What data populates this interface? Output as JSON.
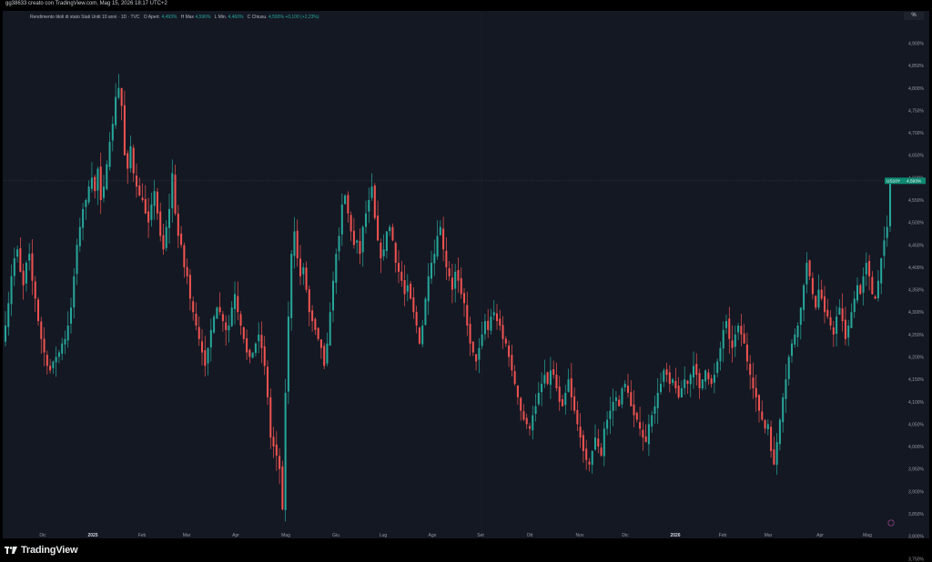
{
  "header": {
    "text": "gg38633 creato con TradingView.com, Mag 15, 2026 18:17 UTC+2"
  },
  "legend": {
    "symbol": "Rendimento titoli di stato Stati Uniti 10 anni · 1D · TVC",
    "open_label": "O",
    "open_name": "Apert.",
    "open": "4,493%",
    "high_label": "H",
    "high_name": "Max",
    "high": "4,596%",
    "low_label": "L",
    "low_name": "Min.",
    "low": "4,460%",
    "close_label": "C",
    "close_name": "Chiusu.",
    "close": "4,593%",
    "change": "+0,100 (+2,23%)"
  },
  "controls": {
    "percent_button": "%"
  },
  "price_tag": {
    "symbol": "US10Y",
    "value": "4,593%"
  },
  "footer": {
    "brand": "TradingView"
  },
  "colors": {
    "up": "#26a69a",
    "down": "#ef5350",
    "background": "#141823",
    "tag": "#0e8a72"
  },
  "chart_data": {
    "type": "candlestick",
    "y_unit": "%",
    "ylim": [
      3.55,
      4.95
    ],
    "y_ticks": [
      "4,900%",
      "4,850%",
      "4,800%",
      "4,750%",
      "4,700%",
      "4,650%",
      "4,600%",
      "4,550%",
      "4,500%",
      "4,450%",
      "4,400%",
      "4,350%",
      "4,300%",
      "4,250%",
      "4,200%",
      "4,150%",
      "4,100%",
      "4,050%",
      "4,000%",
      "3,950%",
      "3,900%",
      "3,850%",
      "3,800%",
      "3,750%"
    ],
    "x_ticks": [
      "Dic",
      "2025",
      "Feb",
      "Mar",
      "Apr",
      "Mag",
      "Giu",
      "Lug",
      "Ago",
      "Set",
      "Ott",
      "Nov",
      "Dic",
      "2026",
      "Feb",
      "Mar",
      "Apr",
      "Mag"
    ],
    "x_ticks_bold": [
      "2025",
      "2026"
    ],
    "closes": [
      4.27,
      4.32,
      4.38,
      4.42,
      4.44,
      4.39,
      4.36,
      4.41,
      4.43,
      4.37,
      4.33,
      4.28,
      4.24,
      4.21,
      4.18,
      4.17,
      4.19,
      4.2,
      4.21,
      4.23,
      4.24,
      4.27,
      4.31,
      4.38,
      4.45,
      4.49,
      4.53,
      4.55,
      4.58,
      4.6,
      4.57,
      4.62,
      4.55,
      4.58,
      4.63,
      4.68,
      4.72,
      4.78,
      4.8,
      4.76,
      4.65,
      4.62,
      4.67,
      4.61,
      4.58,
      4.56,
      4.55,
      4.52,
      4.5,
      4.54,
      4.57,
      4.52,
      4.47,
      4.44,
      4.49,
      4.53,
      4.61,
      4.52,
      4.47,
      4.45,
      4.4,
      4.38,
      4.33,
      4.3,
      4.27,
      4.24,
      4.21,
      4.18,
      4.22,
      4.26,
      4.29,
      4.31,
      4.3,
      4.28,
      4.26,
      4.27,
      4.31,
      4.34,
      4.3,
      4.27,
      4.24,
      4.21,
      4.2,
      4.21,
      4.23,
      4.25,
      4.22,
      4.18,
      4.11,
      4.02,
      4.0,
      3.98,
      3.95,
      3.86,
      4.12,
      4.29,
      4.43,
      4.48,
      4.42,
      4.38,
      4.4,
      4.35,
      4.3,
      4.28,
      4.26,
      4.24,
      4.22,
      4.18,
      4.23,
      4.3,
      4.37,
      4.43,
      4.47,
      4.54,
      4.56,
      4.52,
      4.48,
      4.45,
      4.46,
      4.43,
      4.49,
      4.52,
      4.55,
      4.58,
      4.51,
      4.46,
      4.42,
      4.44,
      4.48,
      4.49,
      4.46,
      4.41,
      4.39,
      4.37,
      4.34,
      4.36,
      4.33,
      4.3,
      4.27,
      4.23,
      4.27,
      4.33,
      4.38,
      4.41,
      4.43,
      4.47,
      4.49,
      4.44,
      4.4,
      4.38,
      4.35,
      4.39,
      4.37,
      4.34,
      4.32,
      4.27,
      4.23,
      4.21,
      4.19,
      4.22,
      4.25,
      4.28,
      4.26,
      4.29,
      4.3,
      4.28,
      4.27,
      4.24,
      4.23,
      4.2,
      4.17,
      4.14,
      4.11,
      4.08,
      4.06,
      4.05,
      4.04,
      4.07,
      4.09,
      4.12,
      4.14,
      4.16,
      4.14,
      4.17,
      4.16,
      4.13,
      4.1,
      4.09,
      4.12,
      4.15,
      4.11,
      4.08,
      4.05,
      4.02,
      3.99,
      3.97,
      3.96,
      3.99,
      4.02,
      4.0,
      3.98,
      4.04,
      4.06,
      4.08,
      4.1,
      4.11,
      4.09,
      4.13,
      4.14,
      4.12,
      4.09,
      4.07,
      4.06,
      4.04,
      4.02,
      4.01,
      4.05,
      4.07,
      4.09,
      4.12,
      4.14,
      4.17,
      4.16,
      4.14,
      4.15,
      4.13,
      4.11,
      4.13,
      4.15,
      4.14,
      4.16,
      4.18,
      4.16,
      4.13,
      4.15,
      4.17,
      4.15,
      4.14,
      4.16,
      4.19,
      4.22,
      4.26,
      4.28,
      4.24,
      4.22,
      4.25,
      4.27,
      4.25,
      4.23,
      4.19,
      4.16,
      4.13,
      4.11,
      4.08,
      4.06,
      4.04,
      4.05,
      3.99,
      3.96,
      4.01,
      4.06,
      4.11,
      4.15,
      4.2,
      4.23,
      4.25,
      4.27,
      4.31,
      4.36,
      4.41,
      4.38,
      4.34,
      4.31,
      4.35,
      4.33,
      4.3,
      4.29,
      4.27,
      4.25,
      4.29,
      4.31,
      4.28,
      4.24,
      4.27,
      4.3,
      4.33,
      4.36,
      4.34,
      4.38,
      4.41,
      4.38,
      4.34,
      4.33,
      4.37,
      4.42,
      4.46,
      4.49,
      4.59
    ]
  }
}
